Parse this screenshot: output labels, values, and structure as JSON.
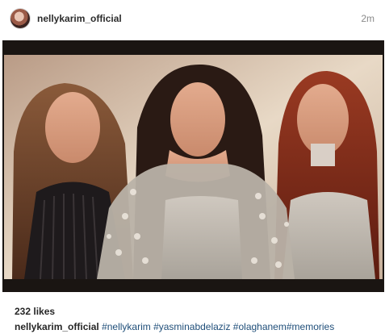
{
  "post": {
    "username": "nellykarim_official",
    "timestamp": "2m",
    "likes": "232 likes",
    "caption": {
      "username": "nellykarim_official",
      "hashtags": "#nellykarim #yasminabdelaziz #olaghanem#memories"
    }
  }
}
